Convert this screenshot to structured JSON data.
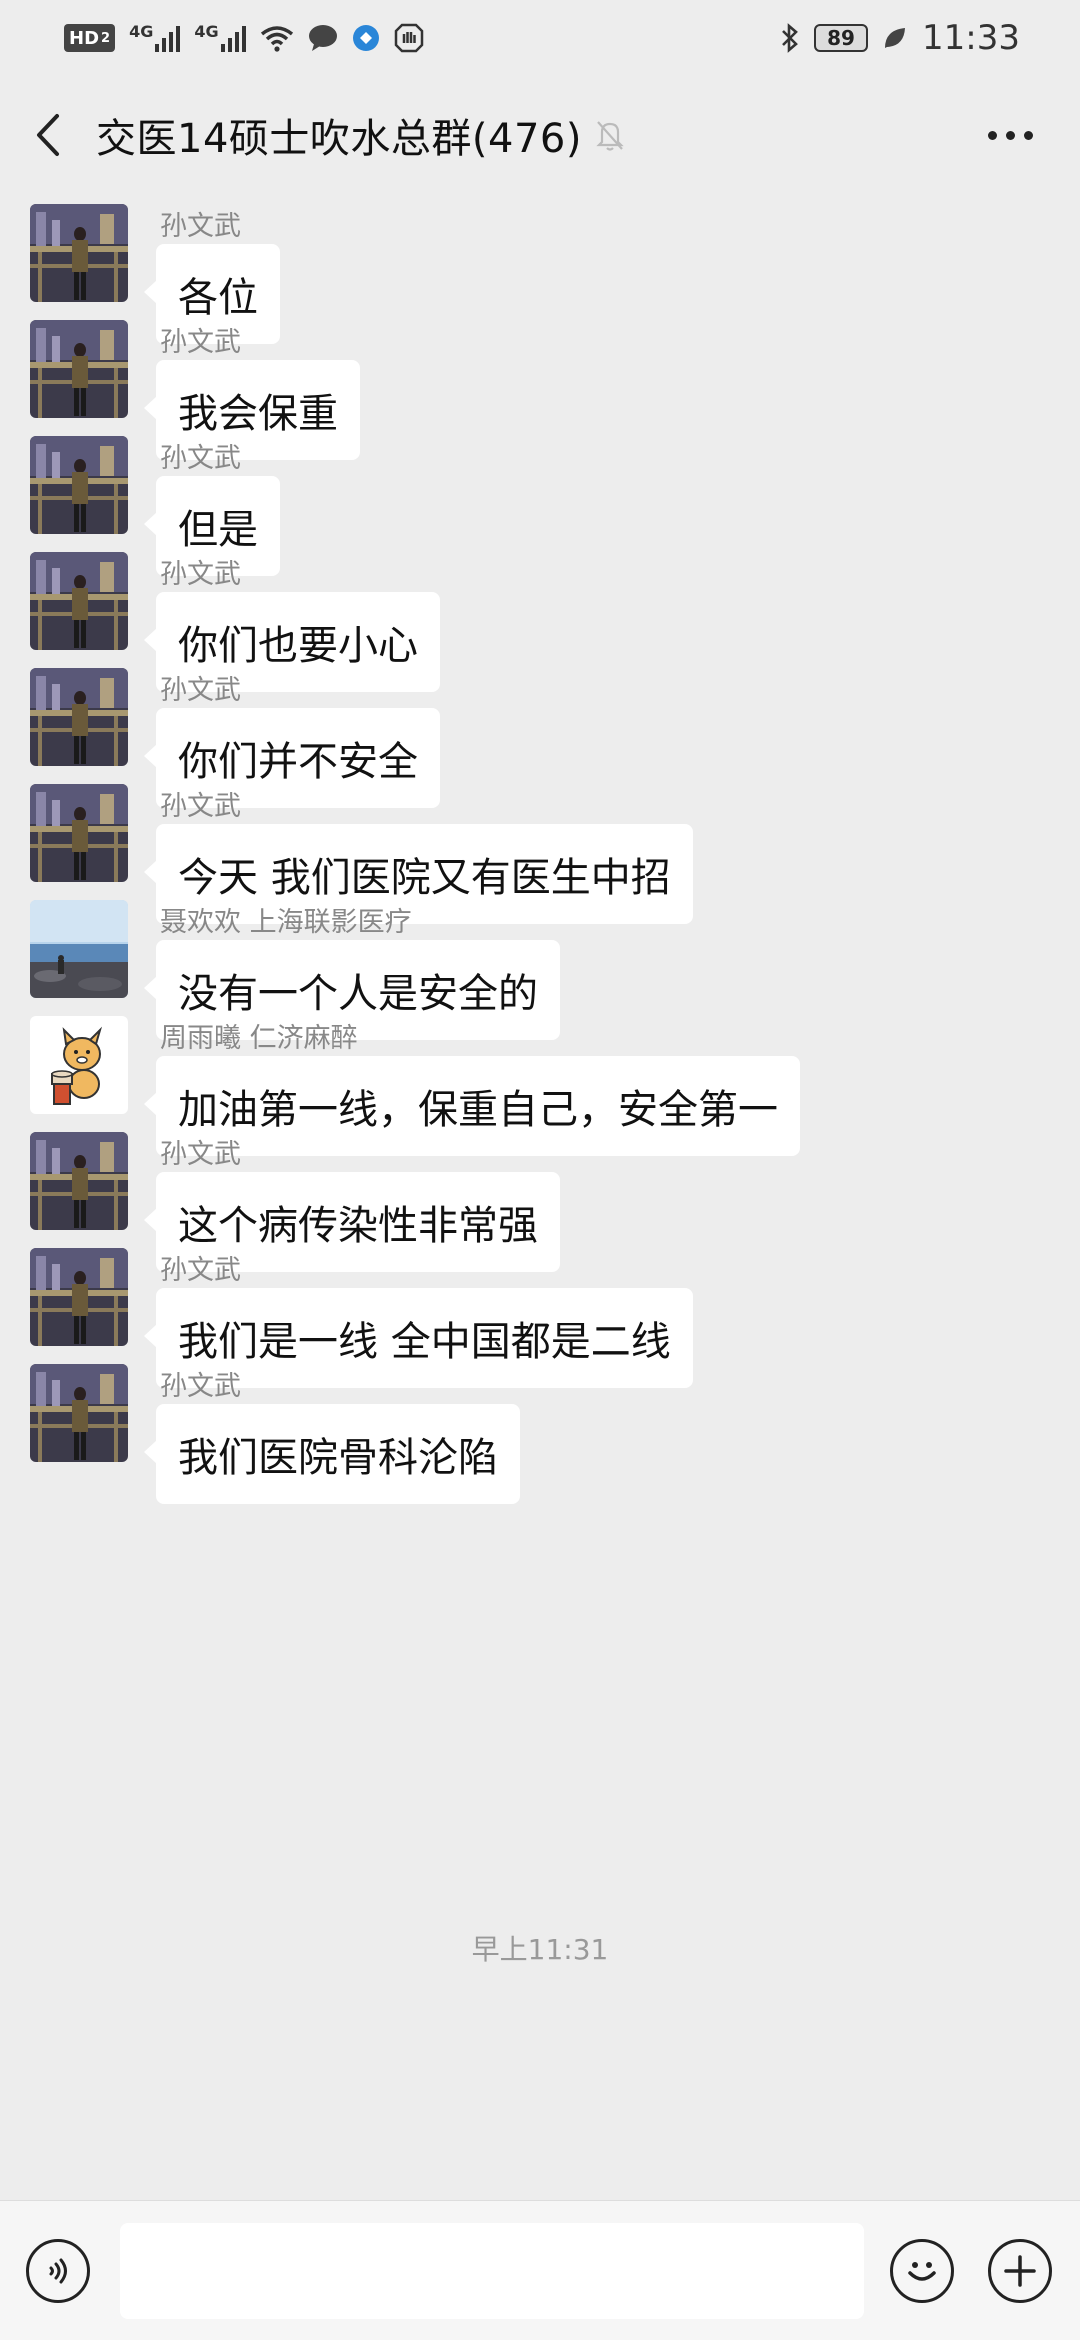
{
  "status_bar": {
    "hd": "HD",
    "hd_sub": "2",
    "net1": "4G",
    "net2": "4G",
    "battery": "89",
    "time": "11:33"
  },
  "header": {
    "title": "交医14硕士吹水总群(476)"
  },
  "messages": [
    {
      "sender": "孙文武",
      "text": "各位",
      "avatar": "night-city-photo"
    },
    {
      "sender": "孙文武",
      "text": "我会保重",
      "avatar": "night-city-photo"
    },
    {
      "sender": "孙文武",
      "text": "但是",
      "avatar": "night-city-photo"
    },
    {
      "sender": "孙文武",
      "text": "你们也要小心",
      "avatar": "night-city-photo"
    },
    {
      "sender": "孙文武",
      "text": "你们并不安全",
      "avatar": "night-city-photo"
    },
    {
      "sender": "孙文武",
      "text": "今天 我们医院又有医生中招",
      "avatar": "night-city-photo"
    },
    {
      "sender": "聂欢欢 上海联影医疗",
      "text": "没有一个人是安全的",
      "avatar": "seaside-photo"
    },
    {
      "sender": "周雨曦 仁济麻醉",
      "text": "加油第一线，保重自己，安全第一",
      "avatar": "cartoon-dog"
    },
    {
      "sender": "孙文武",
      "text": "这个病传染性非常强",
      "avatar": "night-city-photo"
    },
    {
      "sender": "孙文武",
      "text": "我们是一线 全中国都是二线",
      "avatar": "night-city-photo"
    },
    {
      "sender": "孙文武",
      "text": "我们医院骨科沦陷",
      "avatar": "night-city-photo"
    }
  ],
  "timestamp": "早上11:31",
  "input": {
    "placeholder": "",
    "value": ""
  },
  "icons": {
    "back": "chevron-left-icon",
    "mute": "bell-slash-icon",
    "more": "more-dots-icon",
    "voice": "voice-icon",
    "emoji": "emoji-icon",
    "add": "plus-icon"
  }
}
